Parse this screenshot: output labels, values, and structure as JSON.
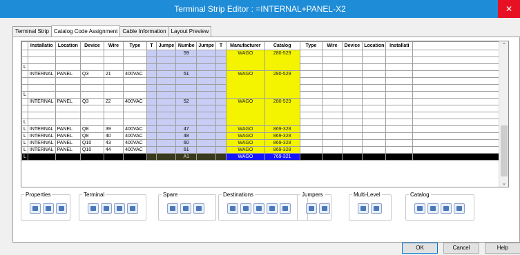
{
  "window": {
    "title": "Terminal Strip Editor : =INTERNAL+PANEL-X2",
    "close_glyph": "✕"
  },
  "tabs": [
    "Terminal Strip",
    "Catalog Code Assignment",
    "Cable Information",
    "Layout Preview"
  ],
  "grid": {
    "headers": [
      "",
      "Installatio",
      "Location",
      "Device",
      "Wire",
      "Type",
      "T",
      "Jumpe",
      "Numbe",
      "Jumpe",
      "T",
      "Manufacturer",
      "Catalog",
      "Type",
      "Wire",
      "Device",
      "Location",
      "Installati",
      ""
    ],
    "partial_row": {
      "l": "L",
      "number": "59",
      "manufacturer": "WAGO",
      "catalog": "280-529"
    },
    "tall_rows": [
      {
        "l": "L",
        "installation": "INTERNAL",
        "location": "PANEL",
        "device": "Q3",
        "wire": "21",
        "type": "400VAC",
        "number": "51",
        "manufacturer": "WAGO",
        "catalog": "280-529"
      },
      {
        "l": "L",
        "installation": "INTERNAL",
        "location": "PANEL",
        "device": "Q3",
        "wire": "22",
        "type": "400VAC",
        "number": "52",
        "manufacturer": "WAGO",
        "catalog": "280-529"
      }
    ],
    "rows": [
      {
        "l": "L",
        "installation": "INTERNAL",
        "location": "PANEL",
        "device": "Q8",
        "wire": "39",
        "type": "400VAC",
        "number": "47",
        "manufacturer": "WAGO",
        "catalog": "869-328"
      },
      {
        "l": "L",
        "installation": "INTERNAL",
        "location": "PANEL",
        "device": "Q8",
        "wire": "40",
        "type": "400VAC",
        "number": "48",
        "manufacturer": "WAGO",
        "catalog": "869-328"
      },
      {
        "l": "L",
        "installation": "INTERNAL",
        "location": "PANEL",
        "device": "Q10",
        "wire": "43",
        "type": "400VAC",
        "number": "60",
        "manufacturer": "WAGO",
        "catalog": "869-328"
      },
      {
        "l": "L",
        "installation": "INTERNAL",
        "location": "PANEL",
        "device": "Q10",
        "wire": "44",
        "type": "400VAC",
        "number": "61",
        "manufacturer": "WAGO",
        "catalog": "869-328"
      }
    ],
    "selected_row": {
      "l": "L",
      "number": "A1",
      "manufacturer": "WAGO",
      "catalog": "769-321"
    },
    "scroll_up": "⌃",
    "scroll_down": "⌄"
  },
  "toolbar": {
    "groups": [
      {
        "label": "Properties",
        "icons": [
          "properties-icon",
          "properties-copy-icon",
          "properties-paste-icon"
        ]
      },
      {
        "label": "Terminal",
        "icons": [
          "terminal-edit-icon",
          "terminal-insert-icon",
          "terminal-multi-icon",
          "terminal-bridge-icon"
        ]
      },
      {
        "label": "Spare",
        "icons": [
          "spare-add-icon",
          "spare-insert-icon",
          "spare-append-icon"
        ]
      },
      {
        "label": "Destinations",
        "icons": [
          "destination-left-icon",
          "destination-both-icon",
          "destination-right-icon",
          "destination-swap-icon",
          "destination-settings-icon"
        ]
      },
      {
        "label": "Jumpers",
        "icons": [
          "jumper-icon",
          "jumper-auto-icon"
        ]
      },
      {
        "label": "Multi-Level",
        "icons": [
          "multilevel-icon",
          "multilevel-edit-icon"
        ]
      },
      {
        "label": "Catalog",
        "icons": [
          "catalog-lookup-icon",
          "catalog-assign-icon",
          "catalog-clear-icon",
          "catalog-update-icon"
        ]
      }
    ]
  },
  "buttons": {
    "ok": "OK",
    "cancel": "Cancel",
    "help": "Help"
  }
}
